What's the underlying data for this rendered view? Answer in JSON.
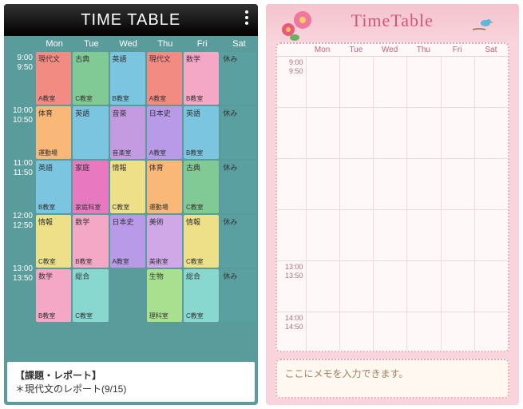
{
  "phone1": {
    "title": "TIME TABLE",
    "days": [
      "Mon",
      "Tue",
      "Wed",
      "Thu",
      "Fri",
      "Sat"
    ],
    "times": [
      {
        "start": "9:00",
        "end": "9:50"
      },
      {
        "start": "10:00",
        "end": "10:50"
      },
      {
        "start": "11:00",
        "end": "11:50"
      },
      {
        "start": "12:00",
        "end": "12:50"
      },
      {
        "start": "13:00",
        "end": "13:50"
      }
    ],
    "cells": [
      [
        {
          "s": "現代文",
          "r": "A教室",
          "c": "c-salmon"
        },
        {
          "s": "古典",
          "r": "C教室",
          "c": "c-green"
        },
        {
          "s": "英語",
          "r": "B教室",
          "c": "c-lblue"
        },
        {
          "s": "現代文",
          "r": "A教室",
          "c": "c-salmon"
        },
        {
          "s": "数学",
          "r": "B教室",
          "c": "c-pink"
        },
        {
          "s": "休み",
          "r": "",
          "c": "c-teal"
        }
      ],
      [
        {
          "s": "体育",
          "r": "運動場",
          "c": "c-orange"
        },
        {
          "s": "英語",
          "r": "",
          "c": "c-lblue"
        },
        {
          "s": "音楽",
          "r": "音楽室",
          "c": "c-purple"
        },
        {
          "s": "日本史",
          "r": "A教室",
          "c": "c-violet"
        },
        {
          "s": "英語",
          "r": "B教室",
          "c": "c-lblue"
        },
        {
          "s": "休み",
          "r": "",
          "c": "c-teal"
        }
      ],
      [
        {
          "s": "英語",
          "r": "B教室",
          "c": "c-lblue"
        },
        {
          "s": "家庭",
          "r": "家庭科室",
          "c": "c-magenta"
        },
        {
          "s": "情報",
          "r": "C教室",
          "c": "c-yellow"
        },
        {
          "s": "体育",
          "r": "運動場",
          "c": "c-orange"
        },
        {
          "s": "古典",
          "r": "C教室",
          "c": "c-green"
        },
        {
          "s": "休み",
          "r": "",
          "c": "c-teal"
        }
      ],
      [
        {
          "s": "情報",
          "r": "C教室",
          "c": "c-yellow"
        },
        {
          "s": "数学",
          "r": "B教室",
          "c": "c-pink"
        },
        {
          "s": "日本史",
          "r": "A教室",
          "c": "c-violet"
        },
        {
          "s": "美術",
          "r": "美術室",
          "c": "c-lpurple"
        },
        {
          "s": "情報",
          "r": "C教室",
          "c": "c-yellow"
        },
        {
          "s": "休み",
          "r": "",
          "c": "c-teal"
        }
      ],
      [
        {
          "s": "数学",
          "r": "B教室",
          "c": "c-pink"
        },
        {
          "s": "総合",
          "r": "C教室",
          "c": "c-cyan"
        },
        {
          "s": "",
          "r": "",
          "c": ""
        },
        {
          "s": "生物",
          "r": "理科室",
          "c": "c-lgreen"
        },
        {
          "s": "総合",
          "r": "C教室",
          "c": "c-cyan"
        },
        {
          "s": "休み",
          "r": "",
          "c": "c-teal"
        }
      ]
    ],
    "memo_title": "【課題・レポート】",
    "memo_body": "＊現代文のレポート(9/15)"
  },
  "phone2": {
    "title": "TimeTable",
    "days": [
      "Mon",
      "Tue",
      "Wed",
      "Thu",
      "Fri",
      "Sat"
    ],
    "times": [
      {
        "start": "9:00",
        "end": "9:50"
      },
      {
        "start": "",
        "end": ""
      },
      {
        "start": "",
        "end": ""
      },
      {
        "start": "",
        "end": ""
      },
      {
        "start": "13:00",
        "end": "13:50"
      },
      {
        "start": "14:00",
        "end": "14:50"
      }
    ],
    "memo": "ここにメモを入力できます。"
  }
}
